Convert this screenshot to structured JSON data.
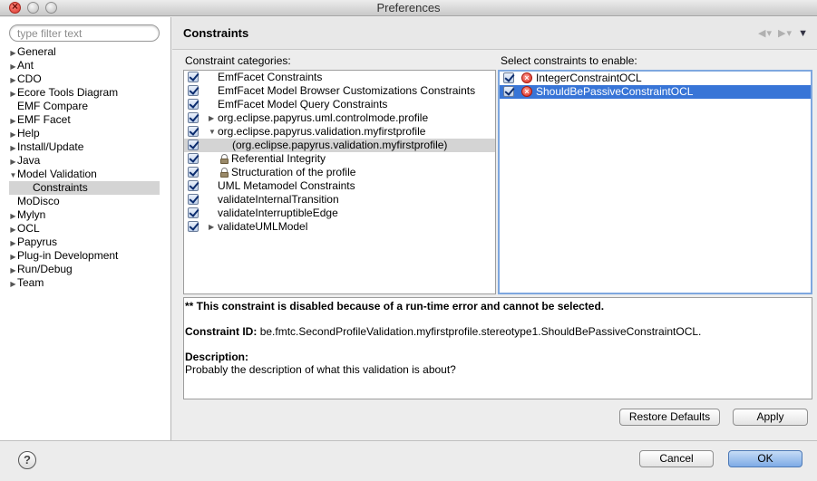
{
  "window": {
    "title": "Preferences"
  },
  "filter": {
    "placeholder": "type filter text"
  },
  "nav_tree": [
    {
      "label": "General",
      "expandable": true,
      "level": 0
    },
    {
      "label": "Ant",
      "expandable": true,
      "level": 0
    },
    {
      "label": "CDO",
      "expandable": true,
      "level": 0
    },
    {
      "label": "Ecore Tools Diagram",
      "expandable": true,
      "level": 0
    },
    {
      "label": "EMF Compare",
      "expandable": false,
      "level": 0
    },
    {
      "label": "EMF Facet",
      "expandable": true,
      "level": 0
    },
    {
      "label": "Help",
      "expandable": true,
      "level": 0
    },
    {
      "label": "Install/Update",
      "expandable": true,
      "level": 0
    },
    {
      "label": "Java",
      "expandable": true,
      "level": 0
    },
    {
      "label": "Model Validation",
      "expandable": true,
      "expanded": true,
      "level": 0
    },
    {
      "label": "Constraints",
      "expandable": false,
      "level": 1,
      "selected": true
    },
    {
      "label": "MoDisco",
      "expandable": false,
      "level": 0
    },
    {
      "label": "Mylyn",
      "expandable": true,
      "level": 0
    },
    {
      "label": "OCL",
      "expandable": true,
      "level": 0
    },
    {
      "label": "Papyrus",
      "expandable": true,
      "level": 0
    },
    {
      "label": "Plug-in Development",
      "expandable": true,
      "level": 0
    },
    {
      "label": "Run/Debug",
      "expandable": true,
      "level": 0
    },
    {
      "label": "Team",
      "expandable": true,
      "level": 0
    }
  ],
  "page": {
    "title": "Constraints",
    "categories_label": "Constraint categories:",
    "constraints_label": "Select constraints to enable:"
  },
  "categories": [
    {
      "label": "EmfFacet Constraints",
      "checked": true,
      "indent": 0,
      "expander": "none",
      "icon": ""
    },
    {
      "label": "EmfFacet Model Browser Customizations Constraints",
      "checked": true,
      "indent": 0,
      "expander": "none",
      "icon": ""
    },
    {
      "label": "EmfFacet Model Query Constraints",
      "checked": true,
      "indent": 0,
      "expander": "none",
      "icon": ""
    },
    {
      "label": "org.eclipse.papyrus.uml.controlmode.profile",
      "checked": true,
      "indent": 0,
      "expander": "collapsed",
      "icon": ""
    },
    {
      "label": "org.eclipse.papyrus.validation.myfirstprofile",
      "checked": true,
      "indent": 0,
      "expander": "expanded",
      "icon": ""
    },
    {
      "label": "(org.eclipse.papyrus.validation.myfirstprofile)",
      "checked": true,
      "indent": 1,
      "expander": "none",
      "icon": "",
      "highlighted": true
    },
    {
      "label": "Referential Integrity",
      "checked": true,
      "indent": 0,
      "expander": "none",
      "icon": "lock"
    },
    {
      "label": "Structuration of the profile",
      "checked": true,
      "indent": 0,
      "expander": "none",
      "icon": "lock"
    },
    {
      "label": "UML Metamodel Constraints",
      "checked": true,
      "indent": 0,
      "expander": "none",
      "icon": ""
    },
    {
      "label": "validateInternalTransition",
      "checked": true,
      "indent": 0,
      "expander": "none",
      "icon": ""
    },
    {
      "label": "validateInterruptibleEdge",
      "checked": true,
      "indent": 0,
      "expander": "none",
      "icon": ""
    },
    {
      "label": "validateUMLModel",
      "checked": true,
      "indent": 0,
      "expander": "collapsed",
      "icon": ""
    }
  ],
  "constraints": [
    {
      "label": "IntegerConstraintOCL",
      "checked": true,
      "icon": "error",
      "selected": false
    },
    {
      "label": "ShouldBePassiveConstraintOCL",
      "checked": true,
      "icon": "error",
      "selected": true
    }
  ],
  "details": {
    "warning": "** This constraint is disabled because of a run-time error and cannot be selected.",
    "id_label": "Constraint ID:",
    "id_value": "be.fmtc.SecondProfileValidation.myfirstprofile.stereotype1.ShouldBePassiveConstraintOCL.",
    "desc_label": "Description:",
    "desc_value": "Probably the description of what this validation is about?"
  },
  "buttons": {
    "restore_defaults": "Restore Defaults",
    "apply": "Apply",
    "cancel": "Cancel",
    "ok": "OK",
    "help": "?"
  },
  "icons": {
    "back": "◀",
    "forward": "▶",
    "dropdown": "▾",
    "menu": "▼",
    "collapsed": "▶",
    "expanded": "▼"
  }
}
